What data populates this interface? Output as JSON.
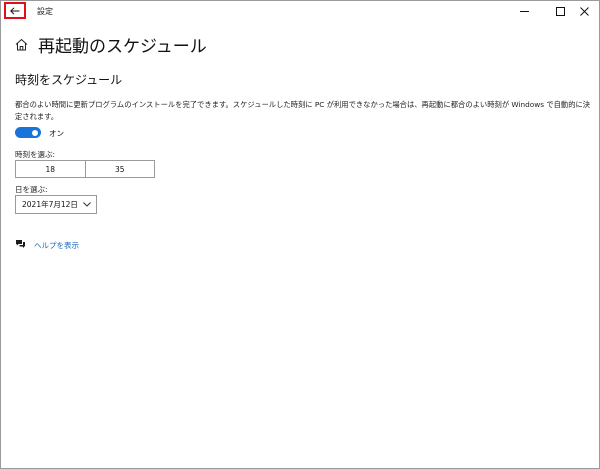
{
  "window": {
    "title": "設定",
    "controls": {
      "minimize": "minimize-icon",
      "maximize": "maximize-icon",
      "close": "close-icon"
    },
    "back_icon": "back-arrow-icon"
  },
  "header": {
    "home_icon": "home-icon",
    "title": "再起動のスケジュール"
  },
  "section": {
    "title": "時刻をスケジュール",
    "description": "都合のよい時間に更新プログラムのインストールを完了できます。スケジュールした時刻に PC が利用できなかった場合は、再起動に都合のよい時刻が Windows で自動的に決定されます。",
    "toggle": {
      "state": "on",
      "label": "オン",
      "color": "#1a73d9"
    }
  },
  "time": {
    "label": "時刻を選ぶ:",
    "hour": "18",
    "minute": "35"
  },
  "day": {
    "label": "日を選ぶ:",
    "selected": "2021年7月12日"
  },
  "help": {
    "icon": "help-chat-icon",
    "label": "ヘルプを表示",
    "color": "#1a66c4"
  }
}
